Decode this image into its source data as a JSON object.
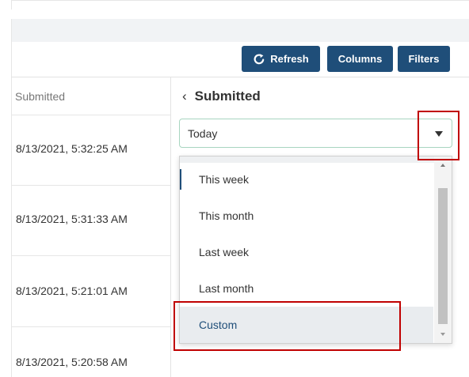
{
  "toolbar": {
    "refresh_label": "Refresh",
    "columns_label": "Columns",
    "filters_label": "Filters"
  },
  "grid": {
    "column_header": "Submitted",
    "rows": [
      "8/13/2021, 5:32:25 AM",
      "8/13/2021, 5:31:33 AM",
      "8/13/2021, 5:21:01 AM",
      "8/13/2021, 5:20:58 AM"
    ]
  },
  "filter_panel": {
    "back_icon": "chevron-left-icon",
    "title": "Submitted",
    "select": {
      "value": "Today",
      "options": [
        "This week",
        "This month",
        "Last week",
        "Last month",
        "Custom"
      ],
      "highlighted": "Custom"
    }
  },
  "colors": {
    "button_bg": "#1f4e79",
    "annotation_red": "#c00000",
    "select_border": "#a8d5c0"
  }
}
